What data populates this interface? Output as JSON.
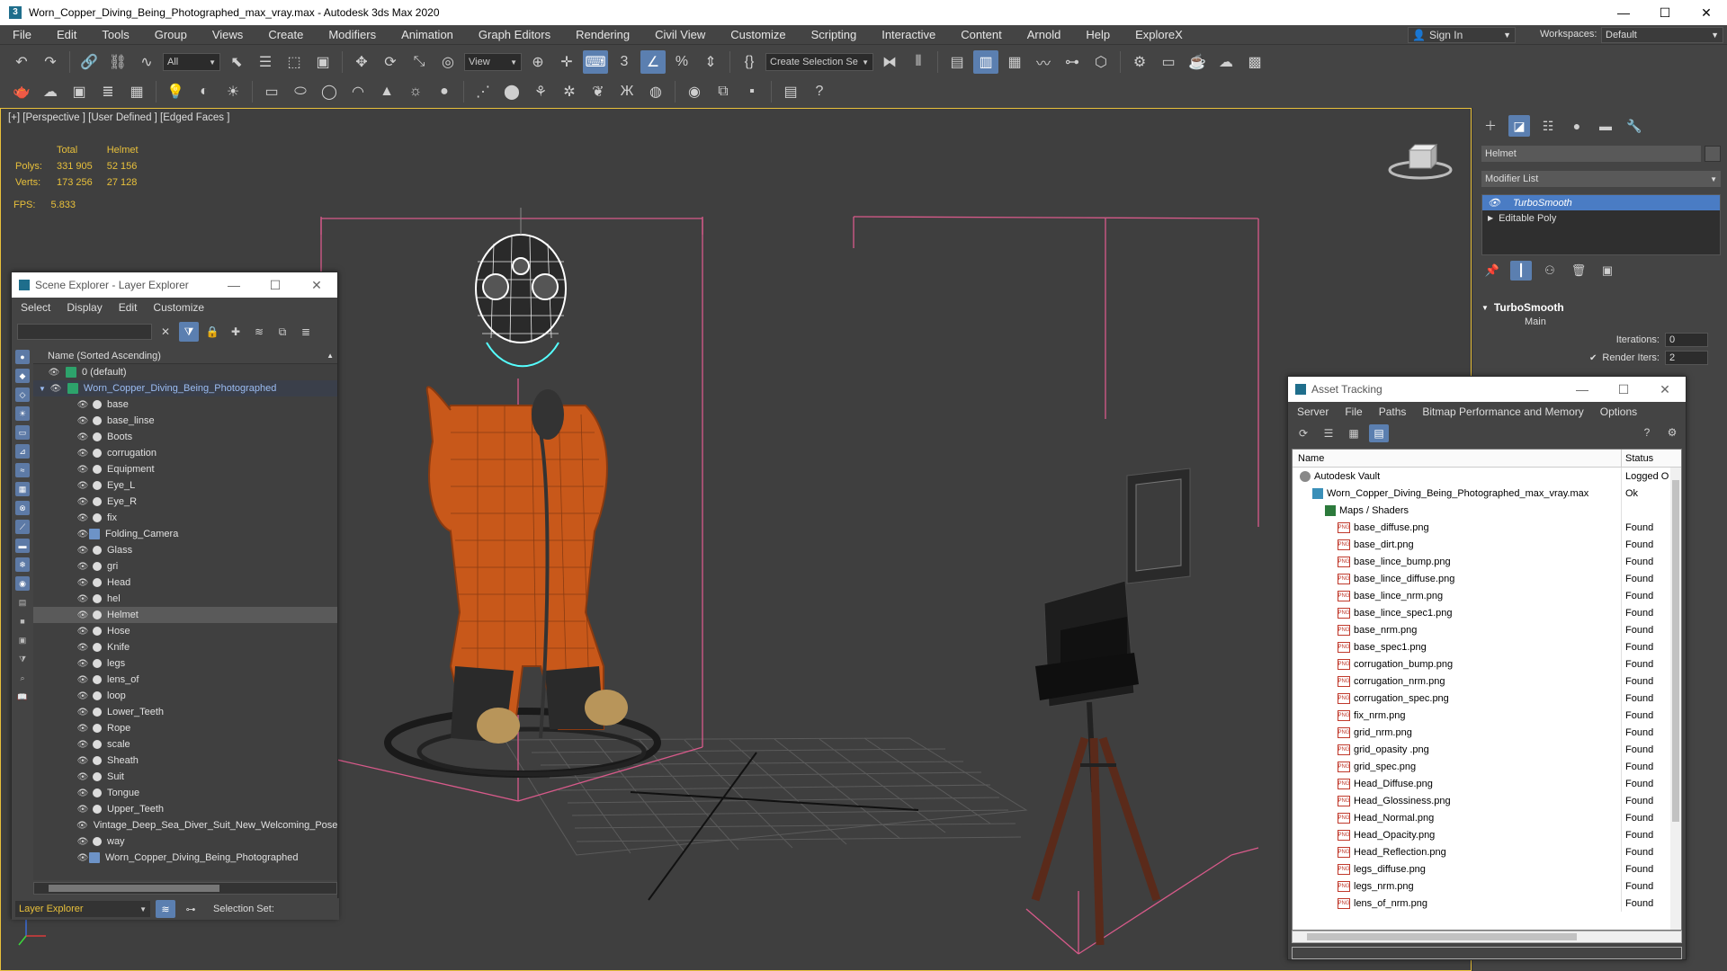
{
  "window": {
    "title": "Worn_Copper_Diving_Being_Photographed_max_vray.max - Autodesk 3ds Max 2020",
    "minimize": "—",
    "maximize": "☐",
    "close": "✕"
  },
  "menubar": {
    "items": [
      "File",
      "Edit",
      "Tools",
      "Group",
      "Views",
      "Create",
      "Modifiers",
      "Animation",
      "Graph Editors",
      "Rendering",
      "Civil View",
      "Customize",
      "Scripting",
      "Interactive",
      "Content",
      "Arnold",
      "Help",
      "ExploreX"
    ],
    "sign_in": "Sign In",
    "workspaces_label": "Workspaces:",
    "workspaces_value": "Default"
  },
  "toolbar": {
    "selection_filter": "All",
    "reference_coord": "View",
    "create_selection_set": "Create Selection Se"
  },
  "viewport": {
    "label": "[+] [Perspective ] [User Defined ] [Edged Faces ]",
    "stats": {
      "col_total": "Total",
      "col_helmet": "Helmet",
      "polys_label": "Polys:",
      "polys_total": "331 905",
      "polys_helmet": "52 156",
      "verts_label": "Verts:",
      "verts_total": "173 256",
      "verts_helmet": "27 128",
      "fps_label": "FPS:",
      "fps_value": "5.833"
    }
  },
  "command_panel": {
    "object_name": "Helmet",
    "modifier_list": "Modifier List",
    "stack": [
      "TurboSmooth",
      "Editable Poly"
    ],
    "rollout_title": "TurboSmooth",
    "section_main": "Main",
    "iterations_label": "Iterations:",
    "iterations_value": "0",
    "render_iters_label": "Render Iters:",
    "render_iters_value": "2"
  },
  "scene_explorer": {
    "title": "Scene Explorer - Layer Explorer",
    "menu": [
      "Select",
      "Display",
      "Edit",
      "Customize"
    ],
    "column_header": "Name (Sorted Ascending)",
    "default_layer": "0 (default)",
    "parent_layer": "Worn_Copper_Diving_Being_Photographed",
    "items": [
      "base",
      "base_linse",
      "Boots",
      "corrugation",
      "Equipment",
      "Eye_L",
      "Eye_R",
      "fix",
      "Folding_Camera",
      "Glass",
      "gri",
      "Head",
      "hel",
      "Helmet",
      "Hose",
      "Knife",
      "legs",
      "lens_of",
      "loop",
      "Lower_Teeth",
      "Rope",
      "scale",
      "Sheath",
      "Suit",
      "Tongue",
      "Upper_Teeth",
      "Vintage_Deep_Sea_Diver_Suit_New_Welcoming_Pose",
      "way",
      "Worn_Copper_Diving_Being_Photographed"
    ],
    "selected_item": "Helmet",
    "footer_explorer": "Layer Explorer",
    "footer_selection_set": "Selection Set:"
  },
  "asset_tracking": {
    "title": "Asset Tracking",
    "menu": [
      "Server",
      "File",
      "Paths",
      "Bitmap Performance and Memory",
      "Options"
    ],
    "col_name": "Name",
    "col_status": "Status",
    "rows": [
      {
        "name": "Autodesk Vault",
        "status": "Logged O",
        "level": 0,
        "kind": "vault"
      },
      {
        "name": "Worn_Copper_Diving_Being_Photographed_max_vray.max",
        "status": "Ok",
        "level": 1,
        "kind": "max"
      },
      {
        "name": "Maps / Shaders",
        "status": "",
        "level": 2,
        "kind": "maps"
      },
      {
        "name": "base_diffuse.png",
        "status": "Found",
        "level": 3,
        "kind": "png"
      },
      {
        "name": "base_dirt.png",
        "status": "Found",
        "level": 3,
        "kind": "png"
      },
      {
        "name": "base_lince_bump.png",
        "status": "Found",
        "level": 3,
        "kind": "png"
      },
      {
        "name": "base_lince_diffuse.png",
        "status": "Found",
        "level": 3,
        "kind": "png"
      },
      {
        "name": "base_lince_nrm.png",
        "status": "Found",
        "level": 3,
        "kind": "png"
      },
      {
        "name": "base_lince_spec1.png",
        "status": "Found",
        "level": 3,
        "kind": "png"
      },
      {
        "name": "base_nrm.png",
        "status": "Found",
        "level": 3,
        "kind": "png"
      },
      {
        "name": "base_spec1.png",
        "status": "Found",
        "level": 3,
        "kind": "png"
      },
      {
        "name": "corrugation_bump.png",
        "status": "Found",
        "level": 3,
        "kind": "png"
      },
      {
        "name": "corrugation_nrm.png",
        "status": "Found",
        "level": 3,
        "kind": "png"
      },
      {
        "name": "corrugation_spec.png",
        "status": "Found",
        "level": 3,
        "kind": "png"
      },
      {
        "name": "fix_nrm.png",
        "status": "Found",
        "level": 3,
        "kind": "png"
      },
      {
        "name": "grid_nrm.png",
        "status": "Found",
        "level": 3,
        "kind": "png"
      },
      {
        "name": "grid_opasity .png",
        "status": "Found",
        "level": 3,
        "kind": "png"
      },
      {
        "name": "grid_spec.png",
        "status": "Found",
        "level": 3,
        "kind": "png"
      },
      {
        "name": "Head_Diffuse.png",
        "status": "Found",
        "level": 3,
        "kind": "png"
      },
      {
        "name": "Head_Glossiness.png",
        "status": "Found",
        "level": 3,
        "kind": "png"
      },
      {
        "name": "Head_Normal.png",
        "status": "Found",
        "level": 3,
        "kind": "png"
      },
      {
        "name": "Head_Opacity.png",
        "status": "Found",
        "level": 3,
        "kind": "png"
      },
      {
        "name": "Head_Reflection.png",
        "status": "Found",
        "level": 3,
        "kind": "png"
      },
      {
        "name": "legs_diffuse.png",
        "status": "Found",
        "level": 3,
        "kind": "png"
      },
      {
        "name": "legs_nrm.png",
        "status": "Found",
        "level": 3,
        "kind": "png"
      },
      {
        "name": "lens_of_nrm.png",
        "status": "Found",
        "level": 3,
        "kind": "png"
      }
    ]
  },
  "colors": {
    "accent": "#5b7fb0",
    "viewport_border": "#e8c03b",
    "stats_text": "#e8c03b",
    "bounding_box": "#d75a8a",
    "suit": "#c8581a",
    "helmet_wire": "#ffffff"
  }
}
